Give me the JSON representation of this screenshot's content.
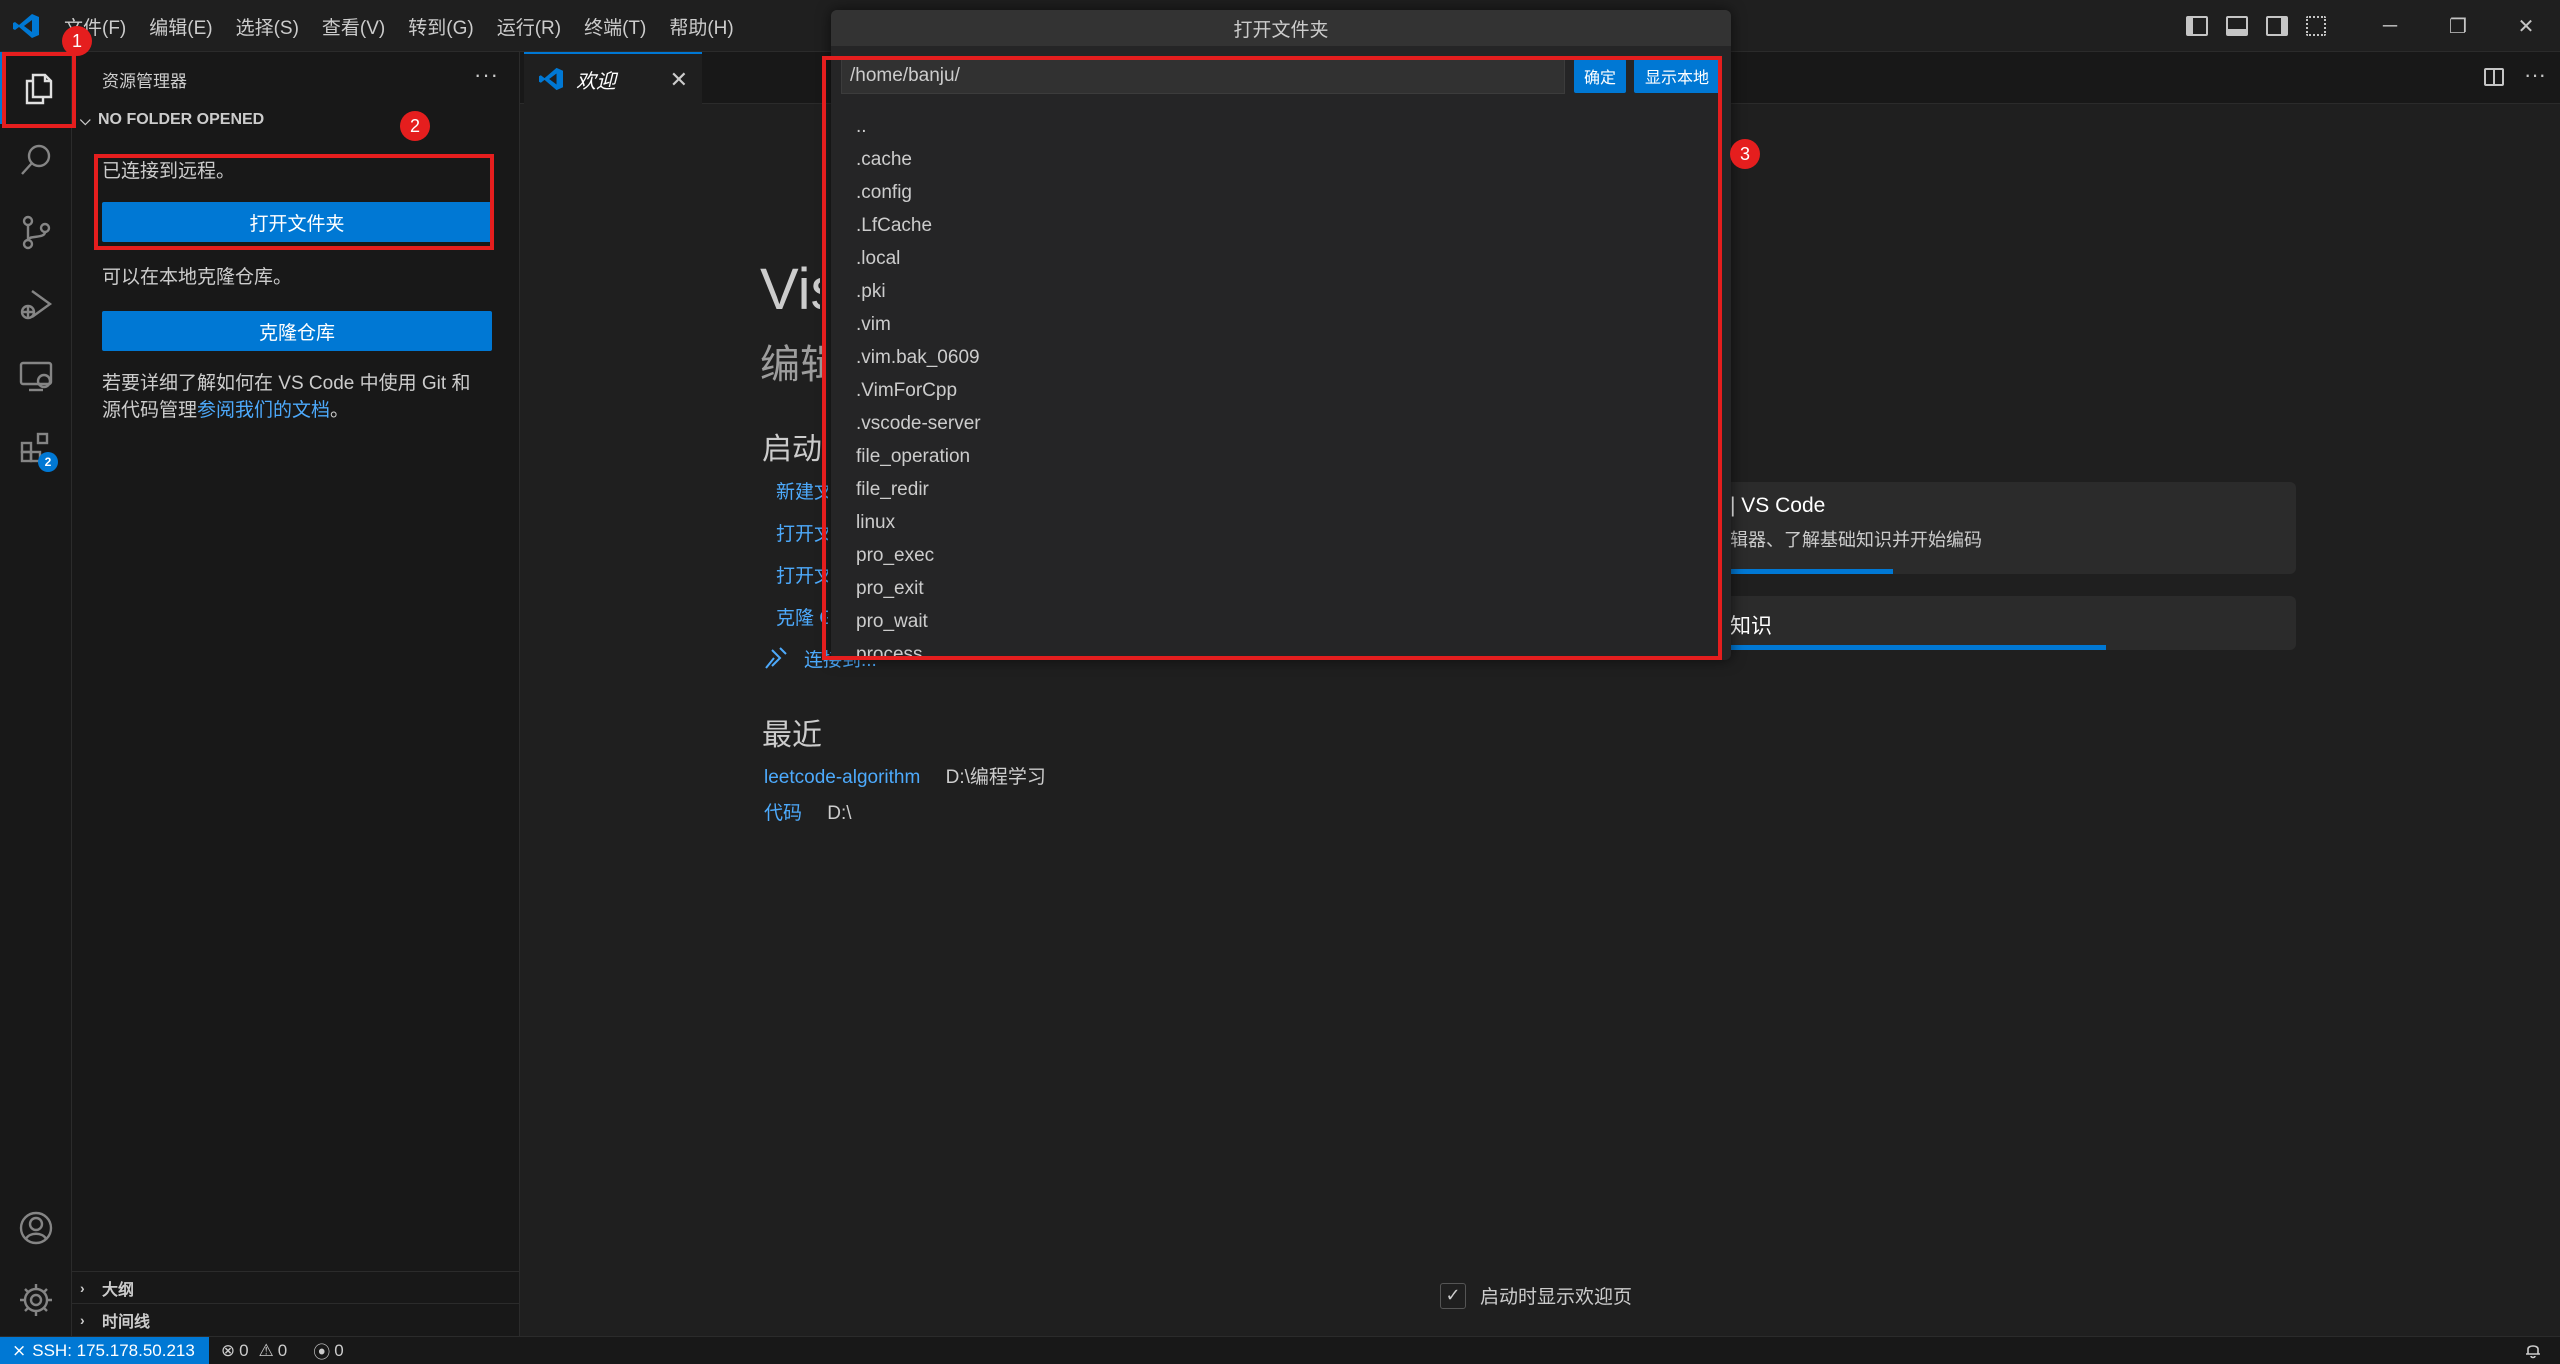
{
  "menu": [
    "文件(F)",
    "编辑(E)",
    "选择(S)",
    "查看(V)",
    "转到(G)",
    "运行(R)",
    "终端(T)",
    "帮助(H)"
  ],
  "window_controls": {
    "minimize": "─",
    "restore": "❐",
    "close": "✕"
  },
  "activity": {
    "extensions_badge": "2"
  },
  "sidebar": {
    "title": "资源管理器",
    "more": "···",
    "section": "NO FOLDER OPENED",
    "connected_text": "已连接到远程。",
    "open_folder_button": "打开文件夹",
    "clone_text": "可以在本地克隆仓库。",
    "clone_button": "克隆仓库",
    "git_help_line1": "若要详细了解如何在 VS Code 中使用 Git 和",
    "git_help_line2_prefix": "源代码管理",
    "git_help_link": "参阅我们的文档",
    "git_help_line2_suffix": "。",
    "outline": "大纲",
    "timeline": "时间线"
  },
  "tab": {
    "label": "欢迎",
    "close": "✕"
  },
  "welcome": {
    "title": "Visual Studio Code",
    "subtitle": "编辑进化",
    "start_heading": "启动",
    "start_items": [
      "新建文件...",
      "打开文件...",
      "打开文件夹...",
      "克隆 Git 仓库...",
      "连接到..."
    ],
    "recent_heading": "最近",
    "recent": [
      {
        "name": "leetcode-algorithm",
        "path": "D:\\编程学习"
      },
      {
        "name": "代码",
        "path": "D:\\"
      }
    ],
    "walkthrough1_title": "| VS Code",
    "walkthrough1_desc": "辑器、了解基础知识并开始编码",
    "walkthrough1_progress": 0.3,
    "walkthrough2_title": "知识",
    "walkthrough2_progress": 0.67,
    "show_on_startup": "启动时显示欢迎页"
  },
  "quickpick": {
    "title": "打开文件夹",
    "path_value": "/home/banju/",
    "ok_button": "确定",
    "show_local_button": "显示本地",
    "items": [
      "..",
      ".cache",
      ".config",
      ".LfCache",
      ".local",
      ".pki",
      ".vim",
      ".vim.bak_0609",
      ".VimForCpp",
      ".vscode-server",
      "file_operation",
      "file_redir",
      "linux",
      "pro_exec",
      "pro_exit",
      "pro_wait",
      "process"
    ]
  },
  "annotations": [
    "1",
    "2",
    "3"
  ],
  "status": {
    "remote": "SSH: 175.178.50.213",
    "errors": "0",
    "warnings": "0",
    "ports": "0"
  },
  "colors": {
    "accent": "#0078d4",
    "annotation": "#e51e1e",
    "link": "#4daafc"
  }
}
